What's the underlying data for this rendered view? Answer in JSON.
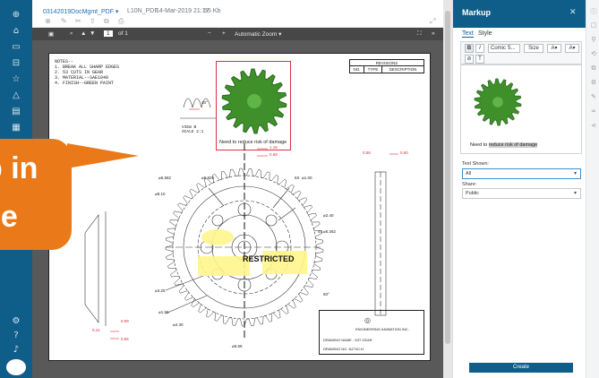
{
  "header": {
    "file_name": "03142019DocMgmt_PDF ▾",
    "file_type": "L10N_PDF",
    "modified": "14-Mar-2019 21:17",
    "size": "55 Kb"
  },
  "viewer_toolbar": {
    "page_input": "1",
    "page_count": "of 1",
    "zoom_label": "Automatic Zoom ▾",
    "zoom_out": "−",
    "zoom_in": "+"
  },
  "drawing": {
    "notes": [
      "NOTES--",
      "1. BREAK ALL SHARP EDGES",
      "2. 53 CUTS IN GEAR",
      "3. MATERIAL--SAE1040",
      "4. FINISH--GREEN PAINT"
    ],
    "view_label": "VIEW B",
    "scale_label": "SCALE 2:1",
    "markup_note": "Need to reduce risk of damage",
    "restricted": "RESTRICTED",
    "revisions_title": "REVISIONS",
    "revisions_cols": [
      "NO.",
      "TYPE",
      "DESCRIPTION"
    ],
    "company": "ENGINEERING ANIMATION INC.",
    "drawing_name": "DRAWING NAME - 53T GEAR",
    "drawing_no": "DRAWING NO. NZ74C11",
    "dims": [
      "⌀6.582",
      "⌀8.825",
      "⌀8.10",
      "⌀1.00",
      "⌀2.40",
      "⌀5.362",
      "⌀3.25",
      "⌀1.50",
      "⌀4.30",
      "⌀5.56",
      "0.41",
      "0.65",
      "0.99",
      "1.16",
      "0.58",
      "0.50",
      "0.58",
      "40°",
      "6X",
      "4X",
      "60°"
    ]
  },
  "callout": {
    "line1": "p in",
    "line2": "ce"
  },
  "markup_panel": {
    "title": "Markup",
    "tabs": [
      "Text",
      "Style"
    ],
    "font_family": "Comic S...",
    "font_size": "Size",
    "bold": "B",
    "italic": "I",
    "note": "Need to reduce risk of damage",
    "note_prefix": "Need to ",
    "note_highlight": "reduce risk of damage",
    "text_shown_label": "Text Shown:",
    "text_shown_value": "All",
    "share_label": "Share:",
    "share_value": "Public",
    "create_label": "Create"
  },
  "colors": {
    "brand": "#0f5e89",
    "callout": "#ea7a19",
    "markup_red": "#d9333f",
    "highlight": "#fff58c",
    "gear_green": "#3f8f2b"
  }
}
